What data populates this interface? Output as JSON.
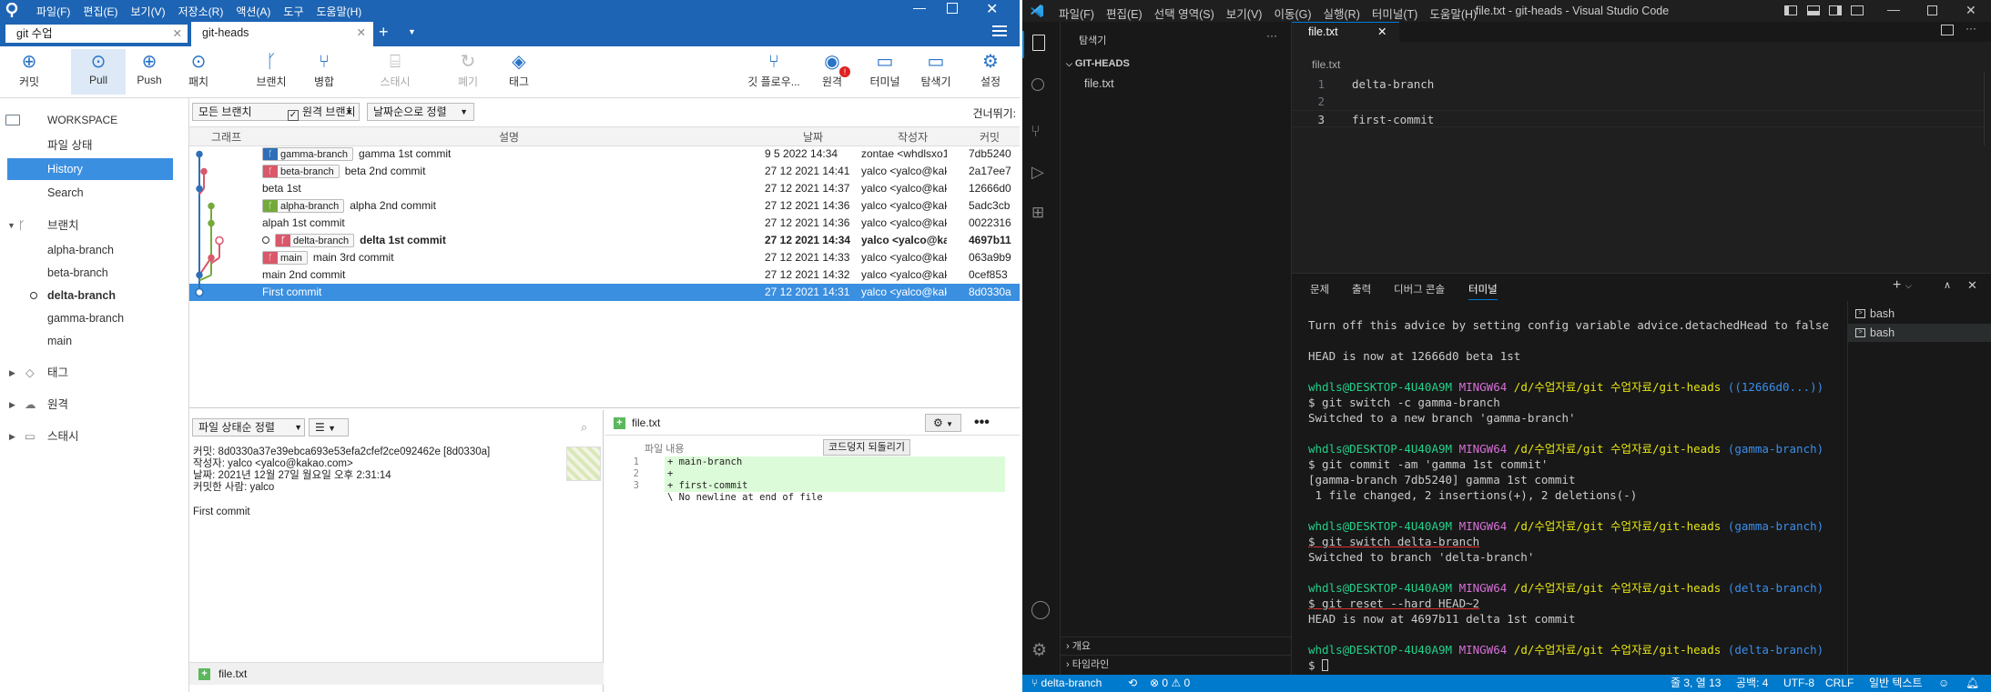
{
  "st": {
    "title": {
      "menus": [
        "파일(F)",
        "편집(E)",
        "보기(V)",
        "저장소(R)",
        "액션(A)",
        "도구",
        "도움말(H)"
      ]
    },
    "tabs": [
      {
        "label": "git 수업"
      },
      {
        "label": "git-heads"
      }
    ],
    "toolbar": [
      "커밋",
      "Pull",
      "Push",
      "패치",
      "브랜치",
      "병합",
      "스태시",
      "폐기",
      "태그",
      "깃 플로우...",
      "원격",
      "터미널",
      "탐색기",
      "설정"
    ],
    "sidebar": {
      "workspace": "WORKSPACE",
      "items": [
        "파일 상태",
        "History",
        "Search"
      ],
      "branches_label": "브랜치",
      "branches": [
        "alpha-branch",
        "beta-branch",
        "delta-branch",
        "gamma-branch",
        "main"
      ],
      "tags_label": "태그",
      "remote_label": "원격",
      "stash_label": "스태시"
    },
    "filter": {
      "all_branches": "모든 브랜치",
      "remote_branch": "원격 브랜치",
      "sort": "날짜순으로 정렬",
      "jump": "건너뛰기:"
    },
    "columns": [
      "그래프",
      "설명",
      "날짜",
      "작성자",
      "커밋"
    ],
    "commits": [
      {
        "branch": "gamma-branch",
        "msg": "gamma 1st commit",
        "date": "9 5 2022 14:34",
        "author": "zontae <whdlsxo1",
        "hash": "7db5240"
      },
      {
        "branch": "beta-branch",
        "msg": "beta 2nd commit",
        "date": "27 12 2021 14:41",
        "author": "yalco <yalco@kak",
        "hash": "2a17ee7"
      },
      {
        "branch": "",
        "msg": "beta 1st",
        "date": "27 12 2021 14:37",
        "author": "yalco <yalco@kak",
        "hash": "12666d0"
      },
      {
        "branch": "alpha-branch",
        "msg": "alpha 2nd commit",
        "date": "27 12 2021 14:36",
        "author": "yalco <yalco@kak",
        "hash": "5adc3cb"
      },
      {
        "branch": "",
        "msg": "alpah 1st commit",
        "date": "27 12 2021 14:36",
        "author": "yalco <yalco@kak",
        "hash": "0022316"
      },
      {
        "branch": "delta-branch",
        "msg": "delta 1st commit",
        "date": "27 12 2021 14:34",
        "author": "yalco <yalco@ka",
        "hash": "4697b11"
      },
      {
        "branch": "main",
        "msg": "main 3rd commit",
        "date": "27 12 2021 14:33",
        "author": "yalco <yalco@kak",
        "hash": "063a9b9"
      },
      {
        "branch": "",
        "msg": "main 2nd commit",
        "date": "27 12 2021 14:32",
        "author": "yalco <yalco@kak",
        "hash": "0cef853"
      },
      {
        "branch": "",
        "msg": "First commit",
        "date": "27 12 2021 14:31",
        "author": "yalco <yalco@kak",
        "hash": "8d0330a"
      }
    ],
    "detail": {
      "sort": "파일 상태순 정렬",
      "commit": "커밋: 8d0330a37e39ebca693e53efa2cfef2ce092462e [8d0330a]",
      "author": "작성자: yalco <yalco@kakao.com>",
      "date": "날짜: 2021년 12월 27일 월요일 오후 2:31:14",
      "committer": "커밋한 사람: yalco",
      "message": "First commit",
      "file": "file.txt"
    },
    "diff": {
      "file": "file.txt",
      "header": "파일 내용",
      "revert": "코드덩지 되돌리기",
      "lines": [
        {
          "n": "1",
          "t": "+ main-branch"
        },
        {
          "n": "2",
          "t": "+"
        },
        {
          "n": "3",
          "t": "+ first-commit"
        },
        {
          "n": "",
          "t": "\\ No newline at end of file"
        }
      ]
    }
  },
  "vs": {
    "menus": [
      "파일(F)",
      "편집(E)",
      "선택 영역(S)",
      "보기(V)",
      "이동(G)",
      "실행(R)",
      "터미널(T)",
      "도움말(H)"
    ],
    "window_title": "file.txt - git-heads - Visual Studio Code",
    "explorer": {
      "title": "탐색기",
      "folder": "GIT-HEADS",
      "file": "file.txt",
      "outline": "개요",
      "timeline": "타임라인"
    },
    "editor": {
      "tab": "file.txt",
      "breadcrumb": "file.txt",
      "lines": [
        {
          "n": "1",
          "t": "delta-branch"
        },
        {
          "n": "2",
          "t": ""
        },
        {
          "n": "3",
          "t": "first-commit"
        }
      ]
    },
    "panel": {
      "tabs": [
        "문제",
        "출력",
        "디버그 콘솔",
        "터미널"
      ],
      "shells": [
        "bash",
        "bash"
      ]
    },
    "terminal": {
      "l1": "Turn off this advice by setting config variable advice.detachedHead to false",
      "l2": "HEAD is now at 12666d0 beta 1st",
      "user": "whdls@DESKTOP-4U40A9M",
      "env": "MINGW64",
      "path": "/d/수업자료/git 수업자료/git-heads",
      "b1": "((12666d0...))",
      "c1": "$ git switch -c gamma-branch",
      "o1": "Switched to a new branch 'gamma-branch'",
      "b2": "(gamma-branch)",
      "c2": "$ git commit -am 'gamma 1st commit'",
      "o2a": "[gamma-branch 7db5240] gamma 1st commit",
      "o2b": " 1 file changed, 2 insertions(+), 2 deletions(-)",
      "c3": "$ git switch delta-branch",
      "o3": "Switched to branch 'delta-branch'",
      "b4": "(delta-branch)",
      "c4": "$ git reset --hard HEAD~2",
      "o4": "HEAD is now at 4697b11 delta 1st commit",
      "prompt": "$ "
    },
    "status": {
      "branch": "delta-branch",
      "problems": "⊗ 0 ⚠ 0",
      "pos": "줄 3, 열 13",
      "spaces": "공백: 4",
      "enc": "UTF-8",
      "eol": "CRLF",
      "lang": "일반 텍스트"
    }
  }
}
